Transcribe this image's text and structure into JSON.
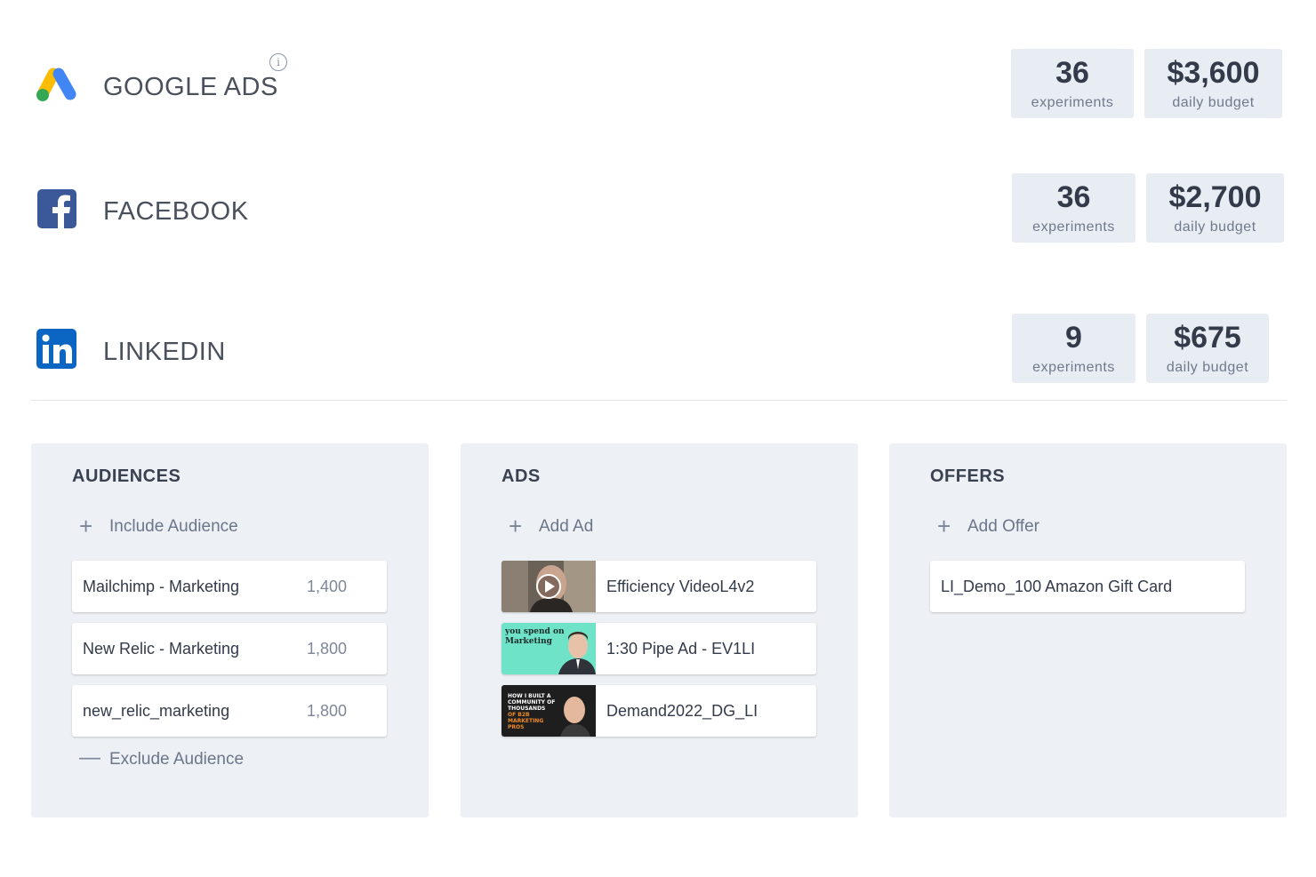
{
  "channels": [
    {
      "name": "GOOGLE ADS",
      "logo": "google-ads-logo",
      "has_info": true,
      "info_icon": "info-icon",
      "experiments": "36",
      "experiments_label": "experiments",
      "budget": "$3,600",
      "budget_label": "daily budget"
    },
    {
      "name": "FACEBOOK",
      "logo": "facebook-logo",
      "experiments": "36",
      "experiments_label": "experiments",
      "budget": "$2,700",
      "budget_label": "daily budget"
    },
    {
      "name": "LINKEDIN",
      "logo": "linkedin-logo",
      "experiments": "9",
      "experiments_label": "experiments",
      "budget": "$675",
      "budget_label": "daily budget"
    }
  ],
  "audiences": {
    "title": "AUDIENCES",
    "add_label": "Include Audience",
    "items": [
      {
        "name": "Mailchimp - Marketing",
        "count": "1,400"
      },
      {
        "name": "New Relic - Marketing",
        "count": "1,800"
      },
      {
        "name": "new_relic_marketing",
        "count": "1,800"
      }
    ],
    "exclude_label": "Exclude Audience"
  },
  "ads": {
    "title": "ADS",
    "add_label": "Add Ad",
    "items": [
      {
        "name": "Efficiency VideoL4v2",
        "thumb": "video-thumbnail"
      },
      {
        "name": "1:30 Pipe Ad - EV1LI",
        "thumb": "pipe-ad-thumbnail",
        "thumb_text": [
          "you spend on",
          "Marketing"
        ]
      },
      {
        "name": "Demand2022_DG_LI",
        "thumb": "demand-thumbnail",
        "thumb_text": [
          "HOW I BUILT A",
          "COMMUNITY OF",
          "THOUSANDS",
          "OF B2B",
          "MARKETING",
          "PROS"
        ]
      }
    ]
  },
  "offers": {
    "title": "OFFERS",
    "add_label": "Add Offer",
    "items": [
      {
        "name": "LI_Demo_100 Amazon Gift Card"
      }
    ]
  },
  "colors": {
    "google_blue": "#4285F4",
    "google_yellow": "#FBBC04",
    "google_green": "#34A853",
    "facebook": "#3b5998",
    "linkedin": "#0a66c2",
    "panel_bg": "#edf0f5",
    "stat_bg": "#e8ecf3"
  }
}
